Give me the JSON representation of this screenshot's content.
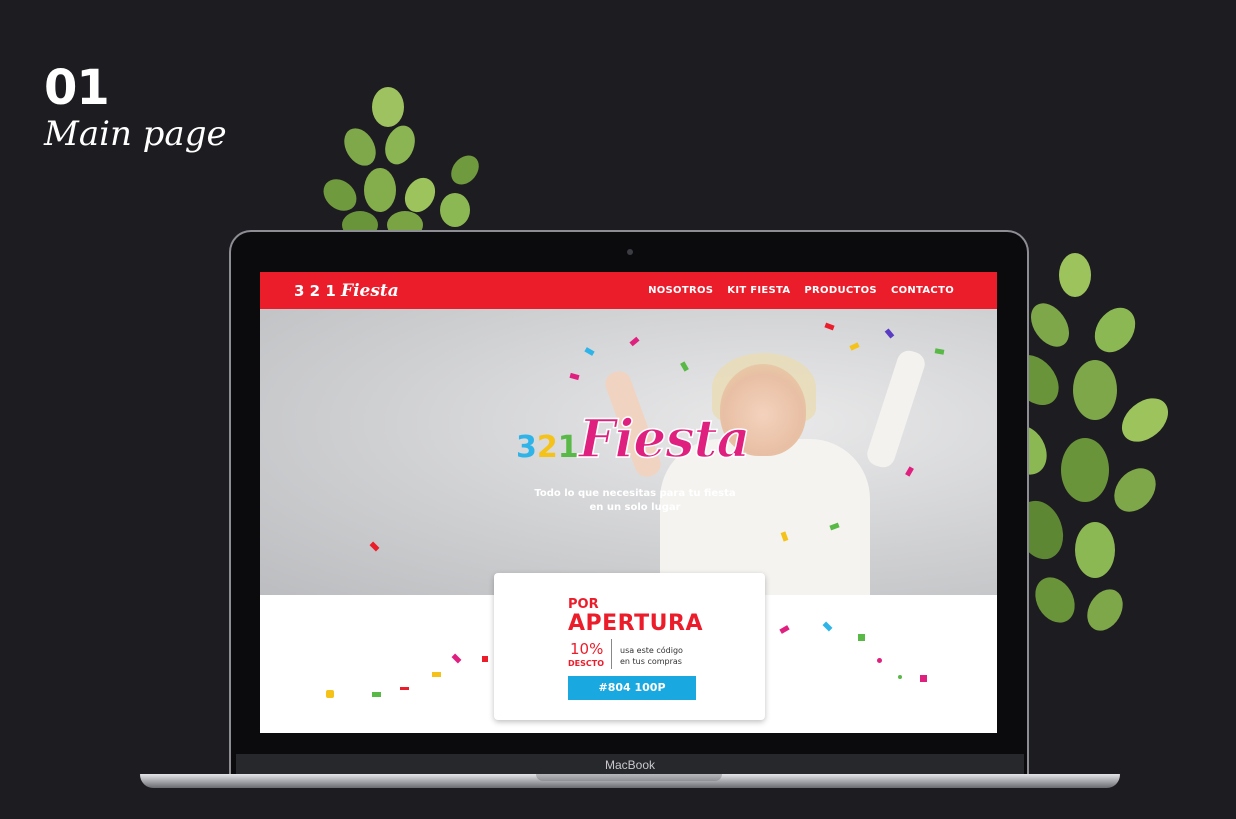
{
  "heading": {
    "number": "01",
    "subtitle": "Main page"
  },
  "laptop": {
    "brand": "MacBook"
  },
  "site": {
    "logo_small": {
      "digits": "3 2 1",
      "word": "Fiesta"
    },
    "nav": [
      "NOSOTROS",
      "KIT FIESTA",
      "PRODUCTOS",
      "CONTACTO"
    ],
    "hero": {
      "logo": {
        "d3": "3",
        "d2": "2",
        "d1": "1",
        "word": "Fiesta"
      },
      "tagline_line1": "Todo lo que necesitas para tu fiesta",
      "tagline_line2": "en un solo lugar"
    },
    "promo": {
      "line1": "POR",
      "line2": "APERTURA",
      "percent": "10%",
      "percent_label": "DESCTO",
      "info_line1": "usa este código",
      "info_line2": "en tus compras",
      "code": "#804 100P"
    }
  },
  "colors": {
    "background": "#1d1c21",
    "brand_red": "#ec1d2b",
    "code_blue": "#1aa8e0",
    "logo_blue": "#2fb4e9",
    "logo_yellow": "#f5c21a",
    "logo_green": "#58b947",
    "logo_magenta": "#e0207f"
  },
  "icons": [
    "plant-left-icon",
    "plant-right-icon",
    "camera-icon",
    "confetti-decoration-icon"
  ]
}
